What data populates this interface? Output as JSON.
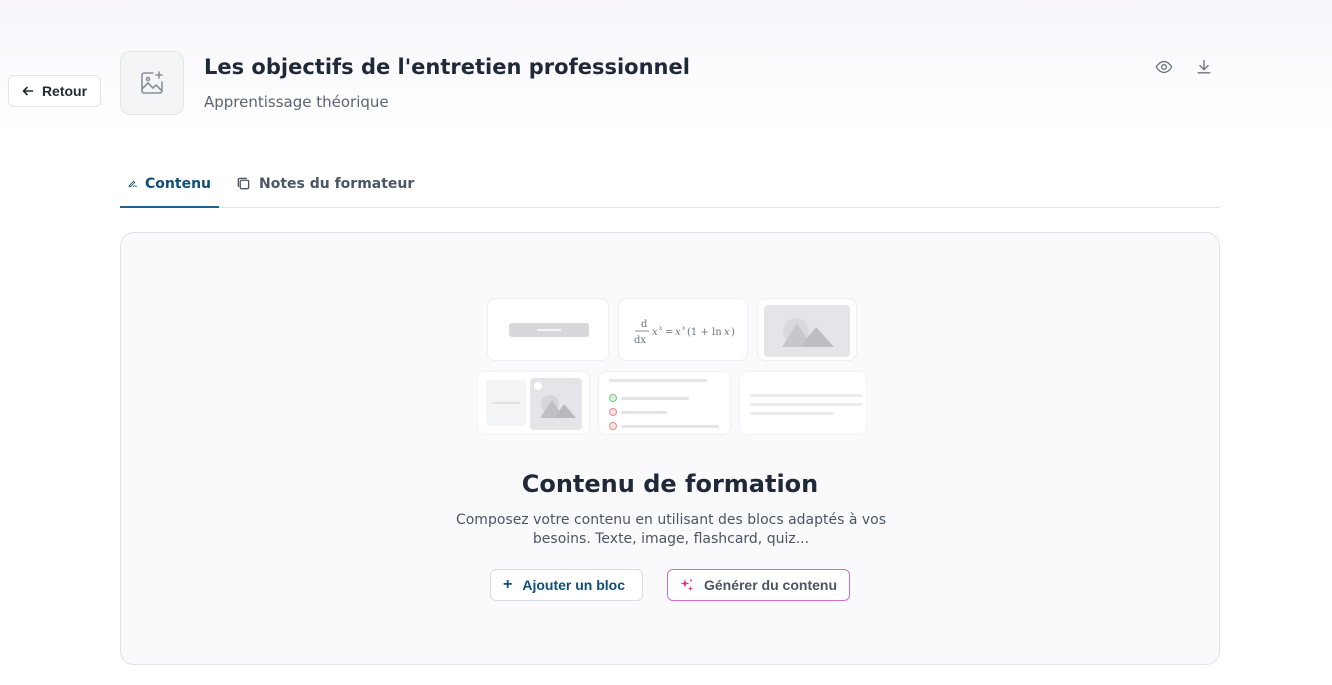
{
  "back": {
    "label": "Retour",
    "icon": "arrow-left-icon"
  },
  "header": {
    "title": "Les objectifs de l'entretien professionnel",
    "subtitle": "Apprentissage théorique",
    "thumbnail_icon": "image-add-icon",
    "actions": [
      {
        "name": "preview",
        "icon": "eye-icon"
      },
      {
        "name": "download",
        "icon": "download-icon"
      }
    ]
  },
  "tabs": [
    {
      "label": "Contenu",
      "icon": "pen-icon",
      "active": true
    },
    {
      "label": "Notes du formateur",
      "icon": "notes-icon",
      "active": false
    }
  ],
  "empty_state": {
    "title": "Contenu de formation",
    "description": "Composez votre contenu en utilisant des blocs adaptés à vos besoins. Texte, image, flashcard, quiz...",
    "add_button": "Ajouter un bloc",
    "generate_button": "Générer du contenu"
  },
  "colors": {
    "accent": "#0e4f78",
    "ai_border": "#d36bcf",
    "ai_icon": "#d6338a"
  }
}
